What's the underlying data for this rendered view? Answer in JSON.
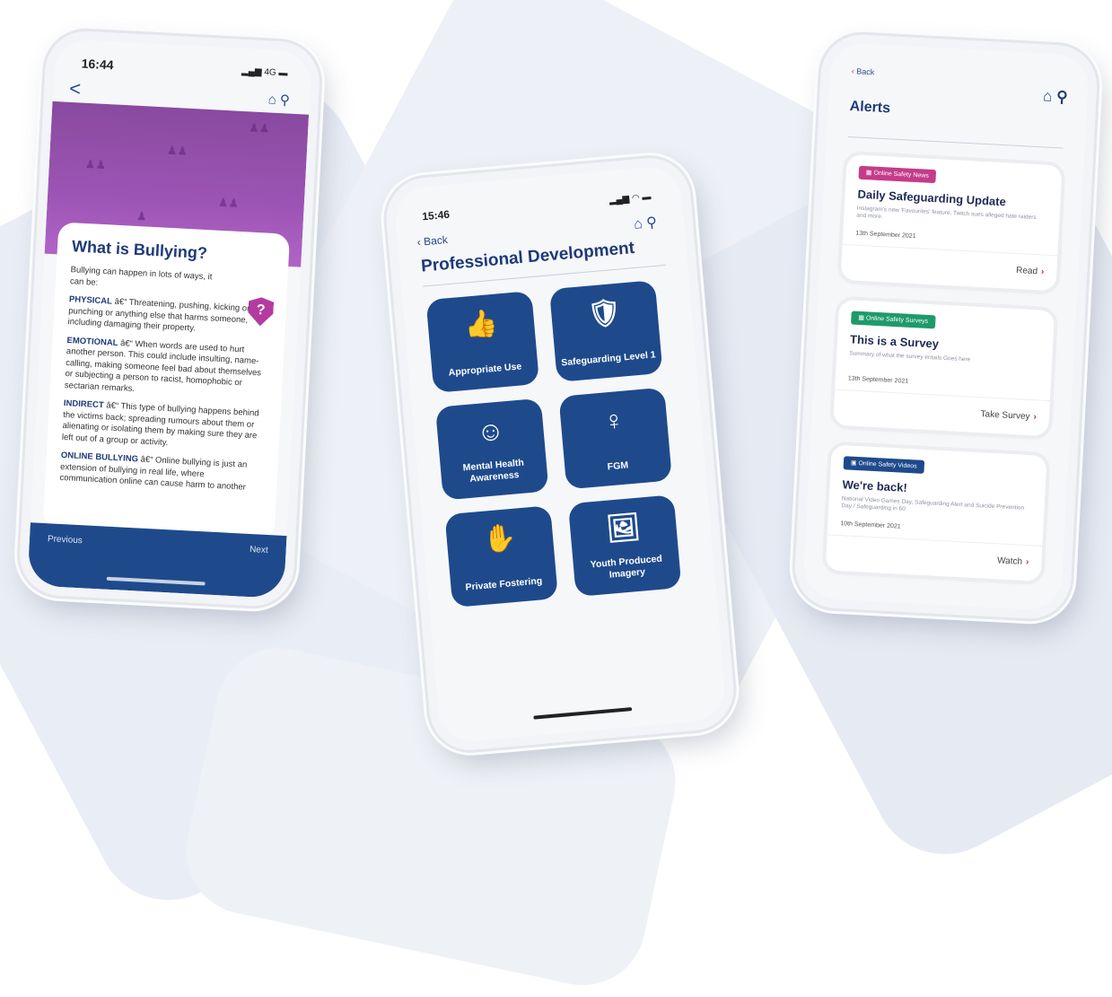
{
  "left_phone": {
    "time": "16:44",
    "signal": "4G",
    "back": "<",
    "title": "What is Bullying?",
    "intro": "Bullying can happen in lots of ways, it can be:",
    "shield_mark": "?",
    "sections": [
      {
        "term": "PHYSICAL",
        "sep": " â€“ ",
        "text": "Threatening, pushing, kicking or punching or anything else that harms someone, including damaging their property."
      },
      {
        "term": "EMOTIONAL",
        "sep": " â€“ ",
        "text": "When words are used to hurt another person. This could include insulting, name-calling, making someone feel bad about themselves or subjecting a person to racist, homophobic or sectarian remarks."
      },
      {
        "term": "INDIRECT",
        "sep": " â€“ ",
        "text": "This type of bullying happens behind the victims back; spreading rumours about them or alienating or isolating them by making sure they are left out of a group or activity."
      },
      {
        "term": "ONLINE BULLYING",
        "sep": " â€“ ",
        "text": "Online bullying is just an extension of bullying in real life, where communication online can cause harm to another"
      }
    ],
    "prev_label": "Previous",
    "next_label": "Next"
  },
  "center_phone": {
    "time": "15:46",
    "back_label": "Back",
    "title": "Professional Development",
    "tiles": [
      {
        "label": "Appropriate Use",
        "icon": "thumbs-up-check-icon",
        "glyph": "👍"
      },
      {
        "label": "Safeguarding Level 1",
        "icon": "shield-one-icon",
        "glyph": "🛡"
      },
      {
        "label": "Mental Health Awareness",
        "icon": "head-heart-icon",
        "glyph": "☺"
      },
      {
        "label": "FGM",
        "icon": "female-symbol-icon",
        "glyph": "♀"
      },
      {
        "label": "Private Fostering",
        "icon": "hand-icon",
        "glyph": "✋"
      },
      {
        "label": "Youth Produced Imagery",
        "icon": "image-icon",
        "glyph": "🖼"
      }
    ]
  },
  "right_phone": {
    "back_label": "Back",
    "title": "Alerts",
    "alerts": [
      {
        "badge": "Online Safety News",
        "badge_color": "#c53b8a",
        "title": "Daily Safeguarding Update",
        "desc": "Instagram's new 'Favourites' feature, Twitch sues alleged hate raiders and more.",
        "date": "13th September 2021",
        "action": "Read"
      },
      {
        "badge": "Online Safety Surveys",
        "badge_color": "#1f9a6b",
        "title": "This is a Survey",
        "desc": "Summary of what the survey entails Goes here",
        "date": "13th September 2021",
        "action": "Take Survey"
      },
      {
        "badge": "Online Safety Videos",
        "badge_color": "#1e4a8c",
        "title": "We're back!",
        "desc": "National Video Games Day, Safeguarding Alert and Suicide Prevention Day / Safeguarding in 60",
        "date": "10th September 2021",
        "action": "Watch"
      }
    ]
  },
  "colors": {
    "brand_navy": "#1e4a8c",
    "hero_purple": "#9c54b4",
    "action_chevron": "#c1245b",
    "background_shape": "#e9edf5"
  }
}
